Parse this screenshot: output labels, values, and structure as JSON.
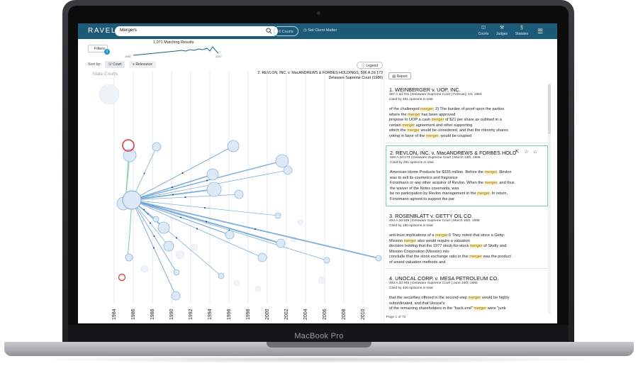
{
  "device": {
    "brand": "MacBook Pro"
  },
  "app": {
    "logo": "RAVEL",
    "search": {
      "value": "Mergers",
      "courts_label": "6 Courts"
    },
    "set_client_matter": "Set Client Matter",
    "nav": [
      {
        "label": "Courts",
        "icon": "courthouse-icon"
      },
      {
        "label": "Judges",
        "icon": "gavel-icon"
      },
      {
        "label": "Statutes",
        "icon": "section-icon"
      }
    ]
  },
  "toolbar": {
    "filters_label": "Filters",
    "filters_count": "1",
    "matching": "1,071 Matching Results",
    "timeline_start": "1982",
    "timeline_end": "2017",
    "sort_by": "Sort by:",
    "sort_court": "Court",
    "sort_relevance": "Relevance",
    "legend": "Legend",
    "report": "Report"
  },
  "graph": {
    "label": "State Courts",
    "focus_case_title": "2. REVLON, INC. v. MacANDREWS & FORBES HOLDINGS, 506 A.2d 173",
    "focus_case_court": "Delaware Supreme Court (1986)",
    "years": [
      "1984",
      "1986",
      "1988",
      "1990",
      "1992",
      "1994",
      "1996",
      "1998",
      "2000",
      "2002",
      "2004",
      "2006",
      "2008",
      "2010"
    ]
  },
  "results": [
    {
      "title": "1. WEINBERGER v. UOP, INC.",
      "meta": "457 A.2d 701 | Delaware Supreme Court | February 1st, 1983",
      "cited": "Cited by 461 opinions in total",
      "lines": [
        [
          "of the challenged ",
          "merger",
          "; 2) The burden of proof upon the parties"
        ],
        [
          "where the ",
          "merger",
          " has been approved"
        ],
        [
          "propose to UOP a cash ",
          "merger",
          " of $21 per share as outlined in a"
        ],
        [
          "certain ",
          "merger",
          " agreement and other supporting"
        ],
        [
          "which the ",
          "merger",
          " would be considered, and that the minority shares"
        ],
        [
          "voting in favor of the ",
          "merger",
          ", would be coupled"
        ]
      ]
    },
    {
      "title": "2. REVLON, INC. v. MacANDREWS & FORBES HOLD",
      "meta": "506 A.2d 173 | Delaware Supreme Court | March 13th, 1986",
      "cited": "Cited by 291 opinions in total",
      "lines": [
        [
          "American Home Products for $335 million. Before the ",
          "merger",
          ", Revlon"
        ],
        [
          "was to sell its cosmetics and fragrance",
          "",
          ""
        ],
        [
          "Forstmann or any other acquiror of Revlon. When the ",
          "merger",
          ", and thus"
        ],
        [
          "the waiver of the Notes covenants, was",
          "",
          ""
        ],
        [
          "be no participation by Revlon management in the ",
          "merger",
          ". In return,"
        ],
        [
          "Forstmann agreed to support the par",
          "",
          ""
        ]
      ]
    },
    {
      "title": "3. ROSENBLATT v. GETTY OIL CO.",
      "meta": "493 A.2d 929 | Delaware Supreme Court | March 15th, 1985",
      "cited": "Cited by 150 opinions in total",
      "lines": [
        [
          "anti-trust implications of a ",
          "merger",
          ".5 They noted that since a Getty-"
        ],
        [
          "Mission ",
          "merger",
          " also would require a valuation",
          ""
        ],
        [
          "decision holding that the 1977 stock-for-stock ",
          "merger",
          " of Skelly and"
        ],
        [
          "Mission Corporation (Mission) into",
          "",
          ""
        ],
        [
          "conclude that the stock exchange ratio in this ",
          "merger",
          " was the product"
        ],
        [
          "of sound valuation methods and",
          "",
          ""
        ]
      ]
    },
    {
      "title": "4. UNOCAL CORP. v. MESA PETROLEUM CO.",
      "meta": "493 A.2d 946 | Delaware Supreme Court | June 10th, 1985",
      "cited": "Cited by 420 opinions in total",
      "lines": [
        [
          "that the securities offered in the second-step ",
          "merger",
          " would be highly"
        ],
        [
          "subordinated, and that Unocal's",
          "",
          ""
        ],
        [
          "of the remaining shareholders in the \"back-end\" ",
          "merger",
          " were \"junk"
        ]
      ]
    }
  ],
  "pagination": "Page 1 of 72"
}
